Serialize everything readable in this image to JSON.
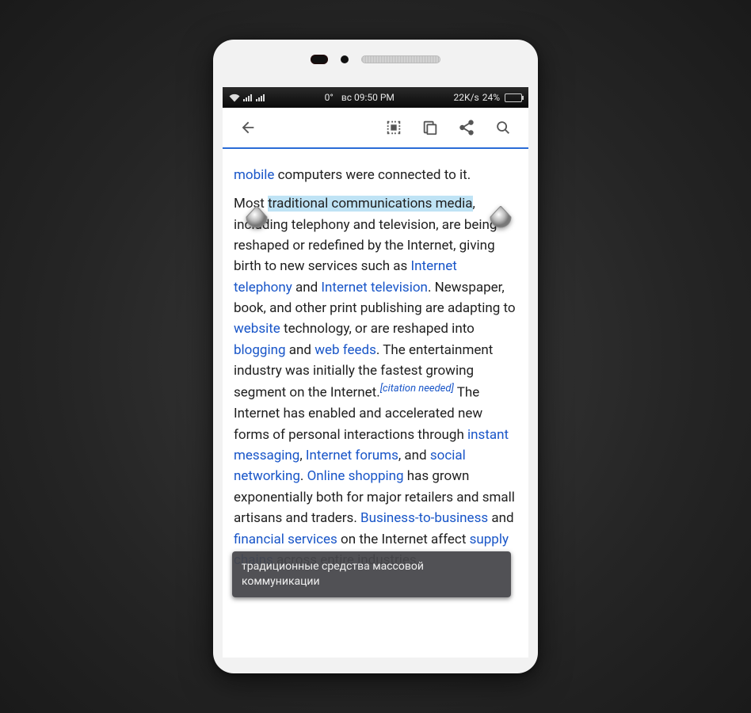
{
  "status_bar": {
    "temp": "0°",
    "day": "вс",
    "time": "09:50 PM",
    "speed": "22K/s",
    "battery_pct": "24%"
  },
  "content": {
    "frag1_link": "mobile",
    "frag1_text": " computers were connected to it.",
    "p2_pre": "Most ",
    "p2_selected": "traditional communications media",
    "p2_after_sel": ", including telephony and television, are being reshaped or redefined by the Internet, giving birth to new services such as ",
    "link_internet_telephony": "Internet telephony",
    "p2_and1": " and ",
    "link_internet_tv": "Internet television",
    "p2_after_tv": ". Newspaper, book, and other print publishing are adapting to ",
    "link_website": "website",
    "p2_after_website": " technology, or are reshaped into ",
    "link_blogging": "blogging",
    "p2_and2": " and ",
    "link_web_feeds": "web feeds",
    "p2_after_feeds": ". The entertainment industry was initially the fastest growing segment on the Internet.",
    "citation": "citation needed",
    "p2_after_cite": " The Internet has enabled and accelerated new forms of personal interactions through ",
    "link_im": "instant messaging",
    "p2_comma1": ", ",
    "link_forums": "Internet forums",
    "p2_and3": ", and ",
    "link_social": "social networking",
    "p2_dot_space": ". ",
    "link_shopping": "Online shopping",
    "p2_after_shopping": " has grown exponentially both for major retailers and small artisans and traders. ",
    "link_b2b": "Business-to-business",
    "p2_and4": " and ",
    "link_fin": "financial services",
    "p2_after_fin": " on the Internet affect ",
    "link_supply": "supply chains",
    "p2_tail": " across entire industries."
  },
  "tooltip": {
    "text": "традиционные средства массовой коммуникации"
  }
}
